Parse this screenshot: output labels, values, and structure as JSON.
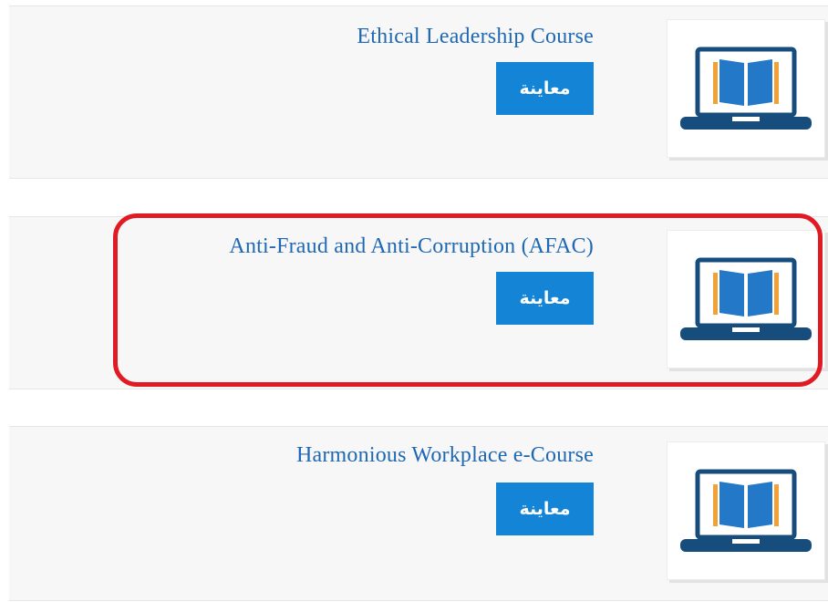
{
  "courses": [
    {
      "title": "Ethical Leadership Course",
      "preview_label": "معاينة",
      "icon": "laptop-book-icon"
    },
    {
      "title": "Anti-Fraud and Anti-Corruption (AFAC)",
      "preview_label": "معاينة",
      "icon": "laptop-book-icon"
    },
    {
      "title": "Harmonious Workplace e-Course",
      "preview_label": "معاينة",
      "icon": "laptop-book-icon"
    }
  ],
  "highlight": {
    "target": "Anti-Fraud and Anti-Corruption (AFAC)",
    "color": "#e01b24"
  },
  "colors": {
    "title_link": "#1f68b3",
    "button_bg": "#1484d6",
    "button_text": "#ffffff",
    "icon_dark": "#174d7c",
    "icon_book": "#2478c8",
    "icon_accent": "#f2a134",
    "card_bg": "#f7f7f7"
  }
}
